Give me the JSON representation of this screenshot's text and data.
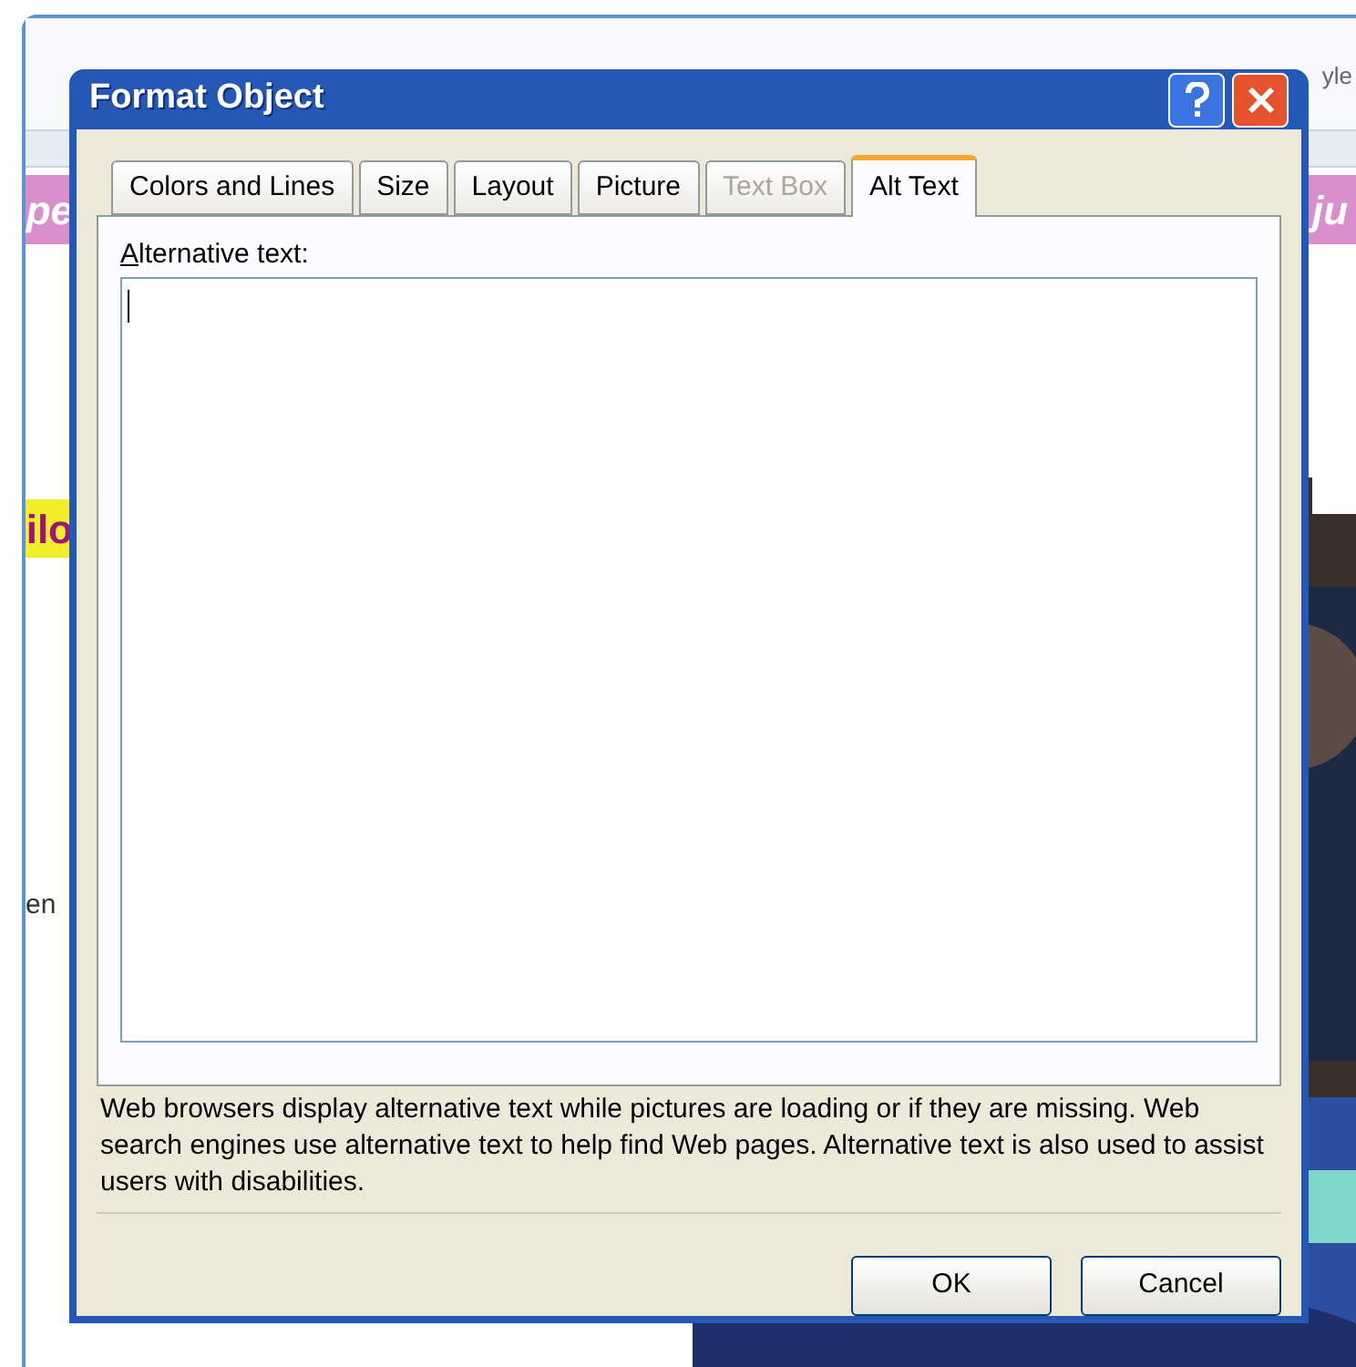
{
  "ribbon": {
    "style_label": "yle"
  },
  "document": {
    "left_fragments": [
      {
        "text": "pe",
        "kind": "banner"
      },
      {
        "text": "ilo",
        "kind": "highlight"
      },
      {
        "text": "en",
        "kind": "plain"
      }
    ],
    "right_fragments": [
      {
        "text": "ju",
        "kind": "banner"
      }
    ]
  },
  "dialog": {
    "title": "Format Object",
    "tabs": [
      {
        "label": "Colors and Lines",
        "selected": false,
        "disabled": false
      },
      {
        "label": "Size",
        "selected": false,
        "disabled": false
      },
      {
        "label": "Layout",
        "selected": false,
        "disabled": false
      },
      {
        "label": "Picture",
        "selected": false,
        "disabled": false
      },
      {
        "label": "Text Box",
        "selected": false,
        "disabled": true
      },
      {
        "label": "Alt Text",
        "selected": true,
        "disabled": false
      }
    ],
    "field_label": "Alternative text:",
    "description": "Web browsers display alternative text while pictures are loading or if they are missing. Web search engines use alternative text to help find Web pages.  Alternative text is also used to assist users with disabilities.",
    "buttons": [
      {
        "label": "OK"
      },
      {
        "label": "Cancel"
      }
    ]
  }
}
